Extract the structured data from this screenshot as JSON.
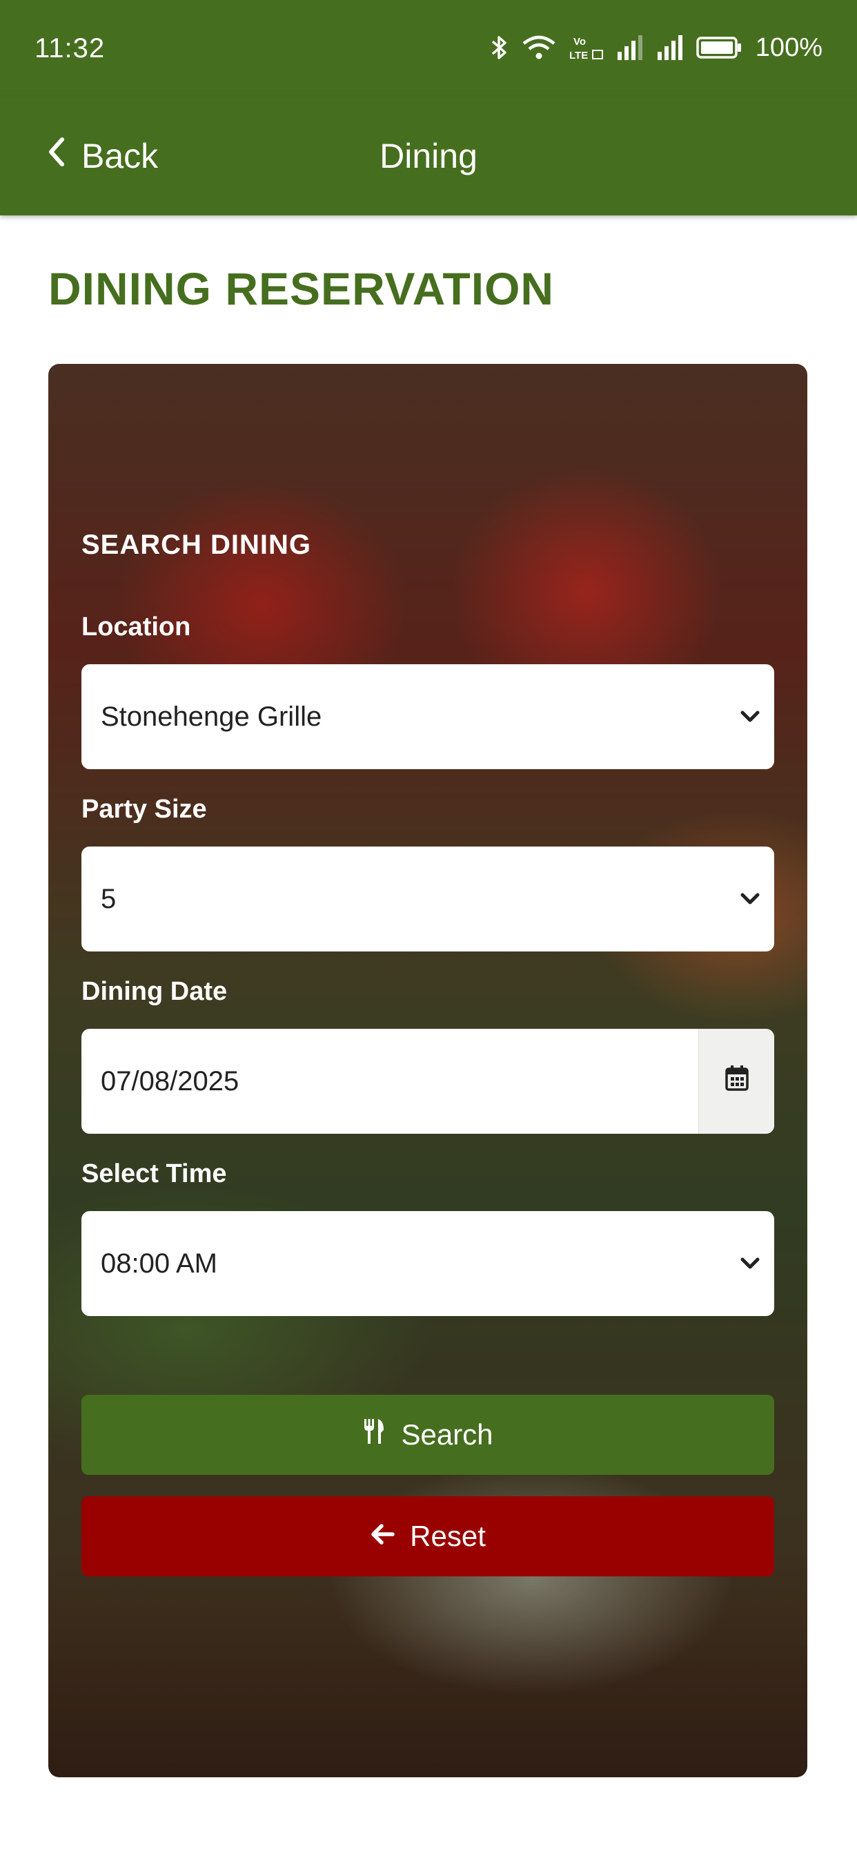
{
  "status_bar": {
    "time": "11:32",
    "battery": "100%",
    "icons": [
      "bluetooth-icon",
      "wifi-icon",
      "volte-icon",
      "signal-icon",
      "signal-icon",
      "battery-icon"
    ]
  },
  "nav": {
    "back_label": "Back",
    "title": "Dining"
  },
  "page": {
    "title": "DINING RESERVATION"
  },
  "form": {
    "section_title": "SEARCH DINING",
    "location": {
      "label": "Location",
      "value": "Stonehenge Grille"
    },
    "party_size": {
      "label": "Party Size",
      "value": "5"
    },
    "dining_date": {
      "label": "Dining Date",
      "value": "07/08/2025"
    },
    "select_time": {
      "label": "Select Time",
      "value": "08:00 AM"
    },
    "search_label": "Search",
    "reset_label": "Reset"
  },
  "colors": {
    "brand_green": "#466e1f",
    "reset_red": "#990000"
  }
}
